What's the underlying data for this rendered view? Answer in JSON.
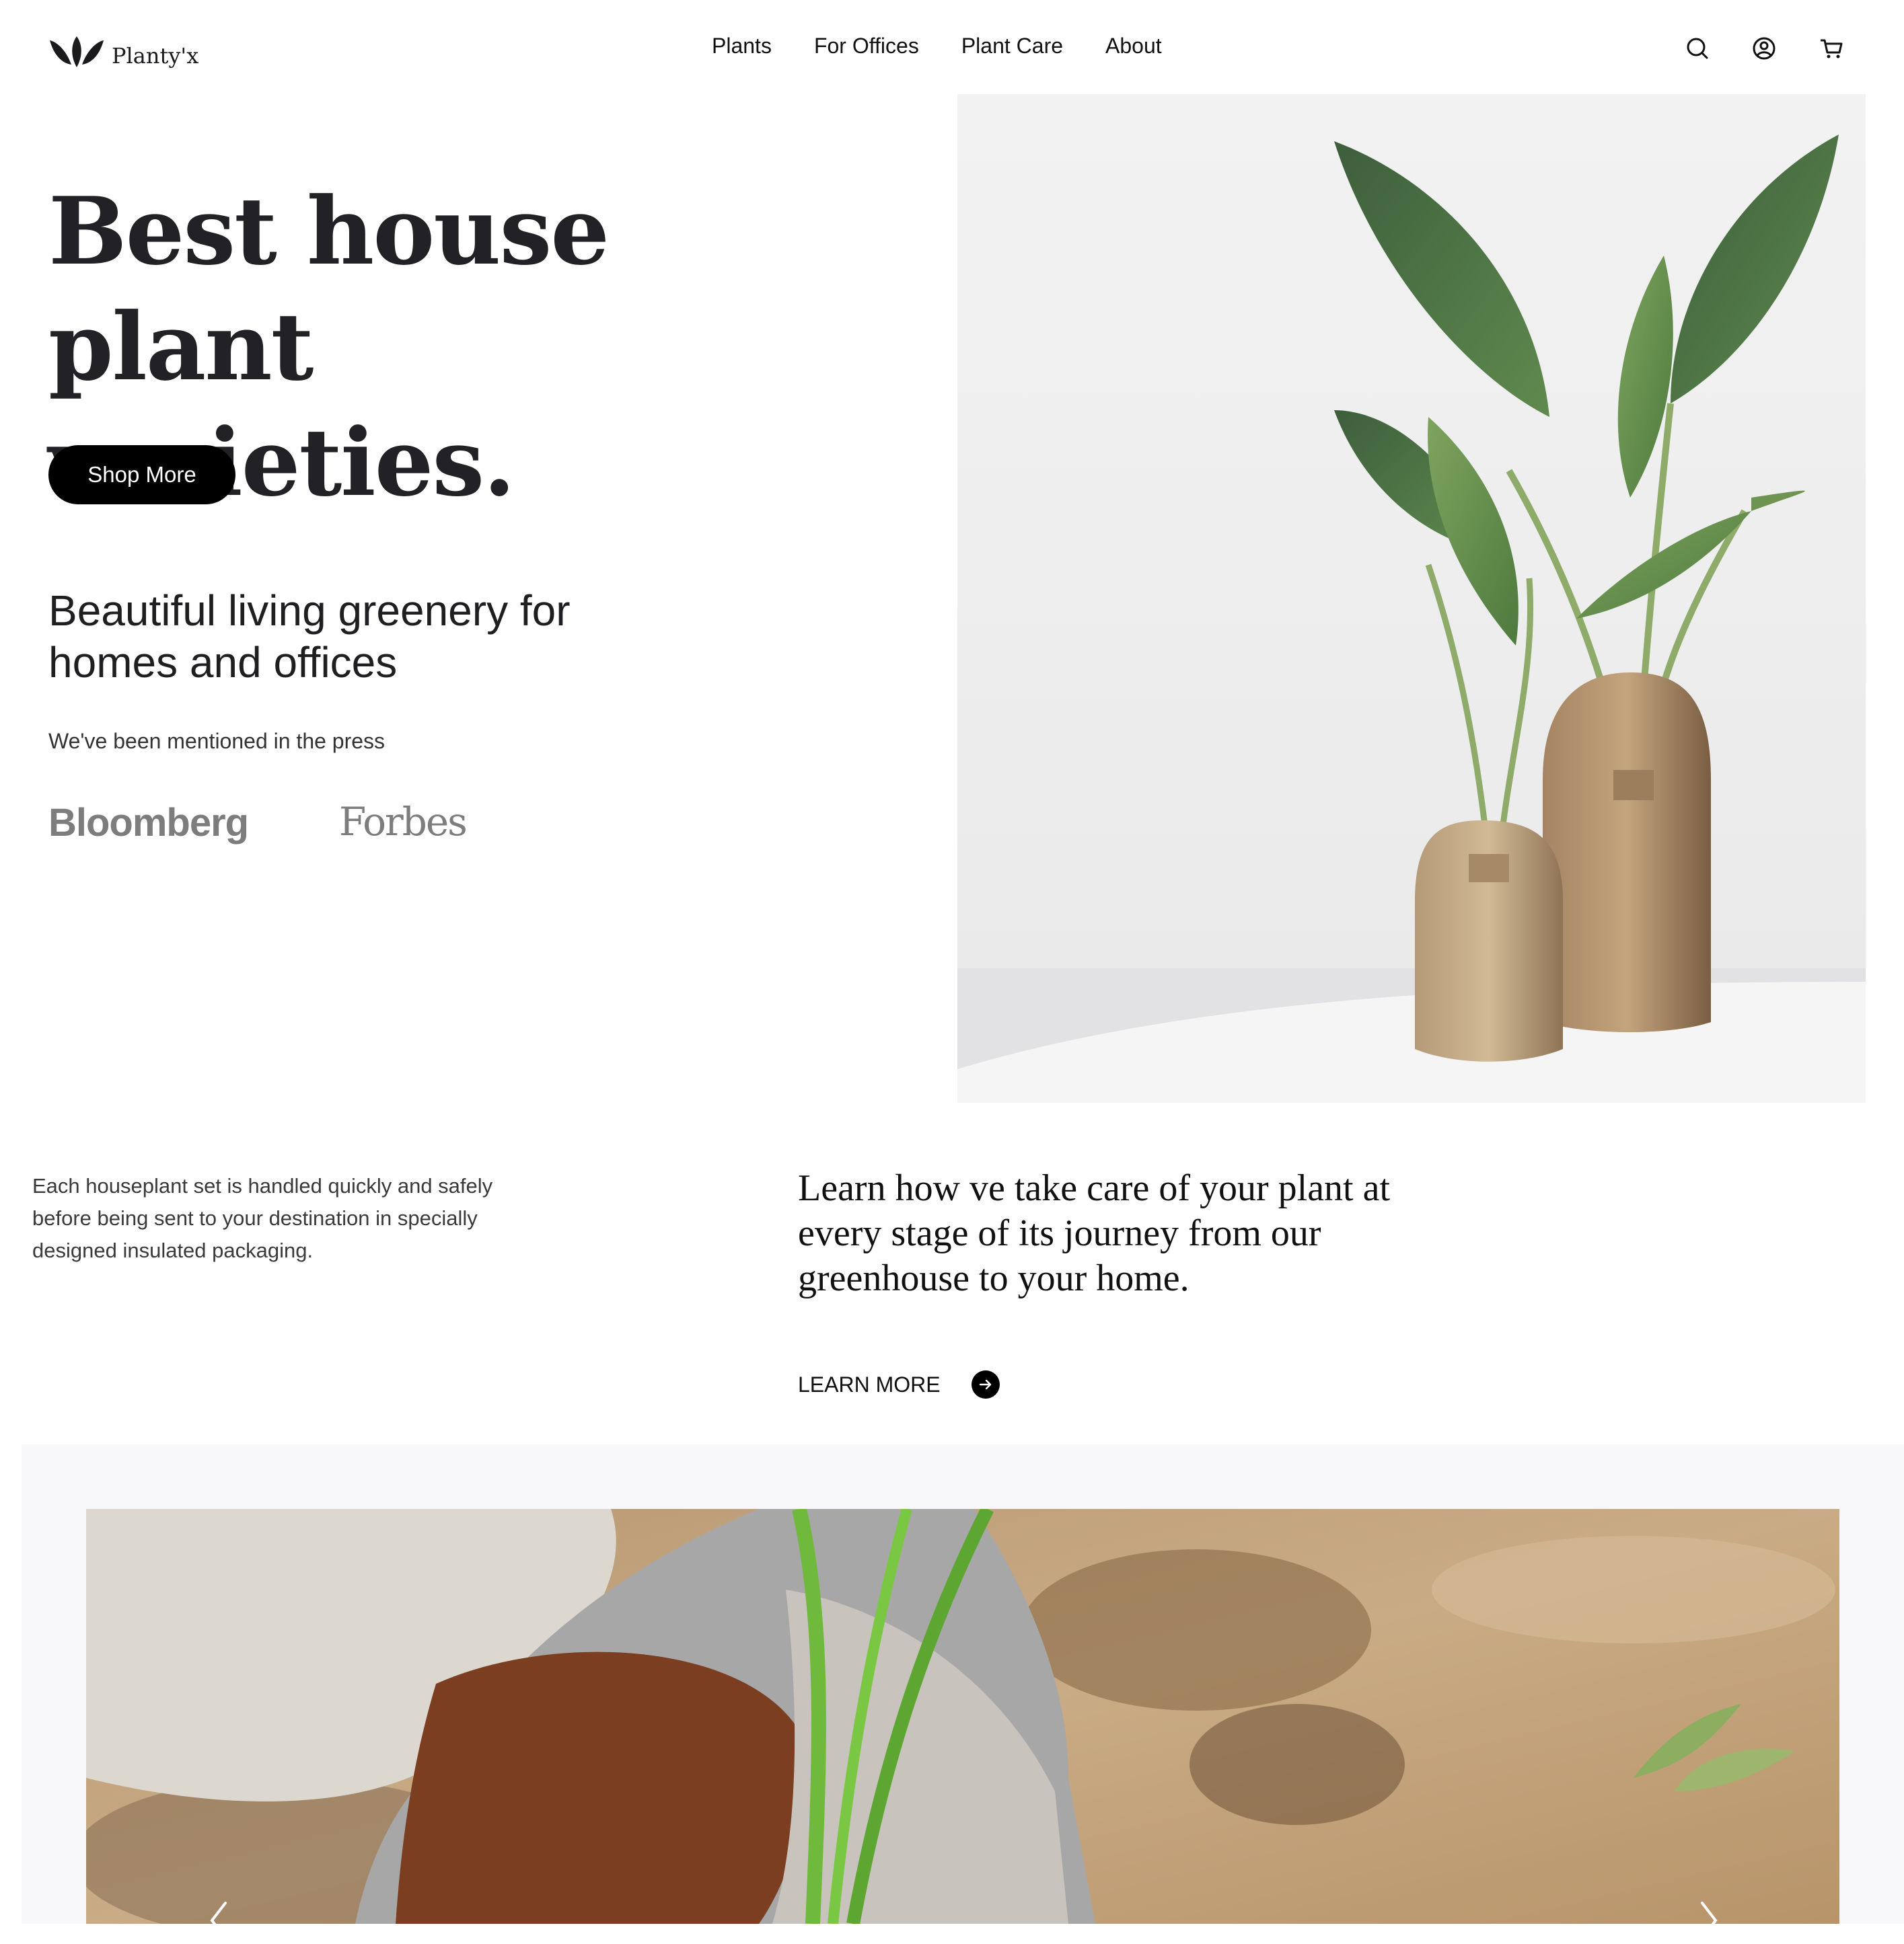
{
  "brand": {
    "name": "Planty'x"
  },
  "nav": [
    {
      "label": "Plants"
    },
    {
      "label": "For Offices"
    },
    {
      "label": "Plant Care"
    },
    {
      "label": "About"
    }
  ],
  "header_icons": [
    "search-icon",
    "user-icon",
    "cart-icon"
  ],
  "hero": {
    "title_line1": "Best house",
    "title_line2": "plant varieties.",
    "cta_label": "Shop More",
    "subtitle": "Beautiful living greenery for homes and offices",
    "press_label": "We've been mentioned in the press",
    "press_logos": [
      "Bloomberg",
      "Forbes"
    ]
  },
  "info": {
    "handling_text": "Each houseplant set is handled quickly and safely before being sent to your destination in specially designed insulated packaging.",
    "learn_text": "Learn how ve take care of your plant at every stage of its journey from our greenhouse to your home.",
    "learn_more_label": "LEARN MORE"
  },
  "colors": {
    "background": "#ffffff",
    "text": "#1a1a1d",
    "button": "#000000",
    "press_logo": "#7d7d7d",
    "gallery_bg": "#f8f8fa"
  }
}
